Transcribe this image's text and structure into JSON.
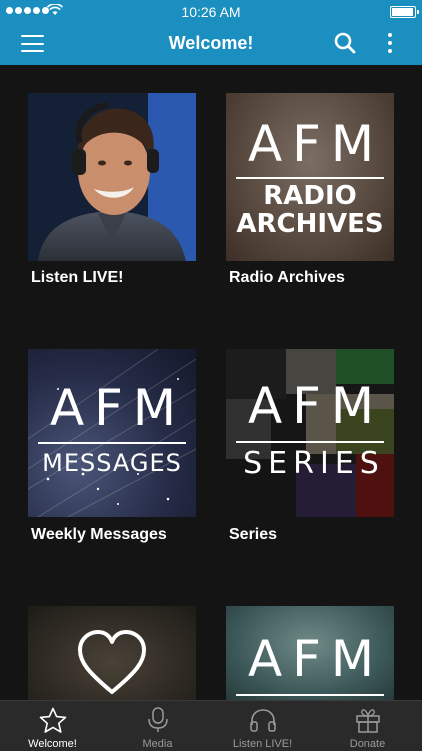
{
  "status_bar": {
    "time": "10:26 AM"
  },
  "header": {
    "title": "Welcome!"
  },
  "tiles": [
    {
      "label": "Listen LIVE!"
    },
    {
      "label": "Radio Archives",
      "art_top": "AFM",
      "art_bottom_1": "RADIO",
      "art_bottom_2": "ARCHIVES"
    },
    {
      "label": "Weekly Messages",
      "art_top": "AFM",
      "art_bottom": "MESSAGES"
    },
    {
      "label": "Series",
      "art_top": "AFM",
      "art_bottom": "SERIES"
    },
    {
      "label": ""
    },
    {
      "label": "",
      "art_top": "AFM"
    }
  ],
  "tabbar": {
    "items": [
      {
        "label": "Welcome!",
        "icon": "star-icon"
      },
      {
        "label": "Media",
        "icon": "microphone-icon"
      },
      {
        "label": "Listen LIVE!",
        "icon": "headphones-icon"
      },
      {
        "label": "Donate",
        "icon": "gift-icon"
      }
    ]
  },
  "colors": {
    "accent": "#1b8fc0",
    "background": "#141414",
    "tabbar": "#2a2a2a"
  }
}
